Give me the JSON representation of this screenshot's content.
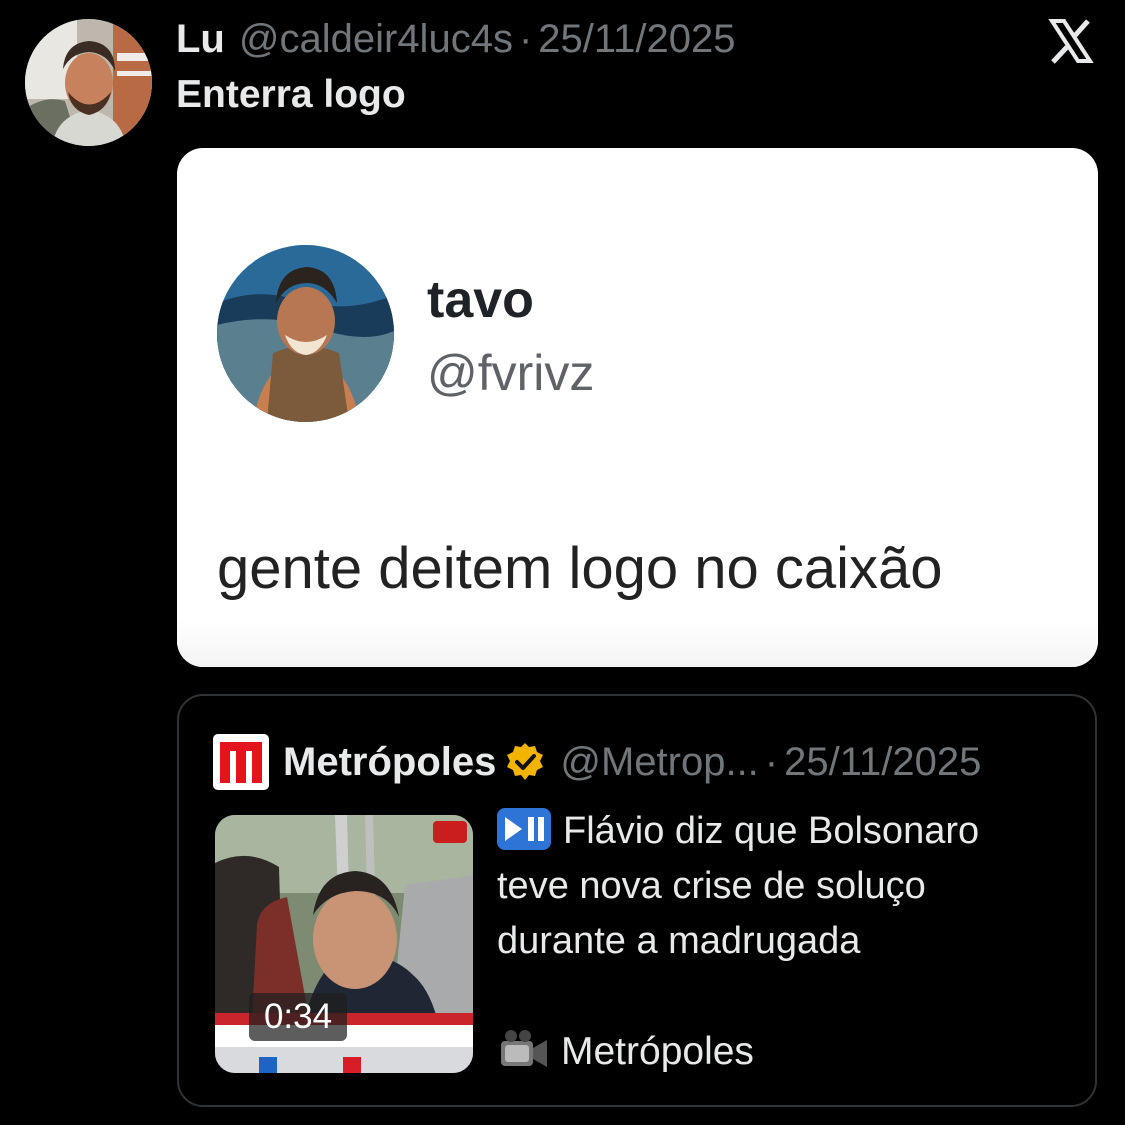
{
  "tweet": {
    "author_name": "Lu",
    "handle": "@caldeir4luc4s",
    "separator": "·",
    "date": "25/11/2025",
    "text": "Enterra logo",
    "avatar_icon": "profile-photo",
    "platform_icon": "x-logo-icon"
  },
  "media": {
    "name": "tavo",
    "handle": "@fvrivz",
    "text": "gente deitem logo no caixão",
    "avatar_icon": "profile-photo"
  },
  "quote": {
    "source_name": "Metrópoles",
    "handle": "@Metrop...",
    "separator": "·",
    "date": "25/11/2025",
    "verified_icon": "gold-verified-badge-icon",
    "logo_icon": "metropoles-logo-icon",
    "thumbnail_duration": "0:34",
    "text": "Flávio diz que Bolsonaro teve nova crise de soluço durante a madrugada",
    "play_pause_icon": "play-pause-emoji-icon",
    "source_label": "Metrópoles",
    "camera_icon": "video-camera-emoji-icon"
  },
  "colors": {
    "background": "#000000",
    "primary_text": "#e7e9ea",
    "secondary_text": "#71767b",
    "card_border": "#2f3336",
    "brand_red": "#e3141d",
    "verified_gold": "#f2b400"
  }
}
